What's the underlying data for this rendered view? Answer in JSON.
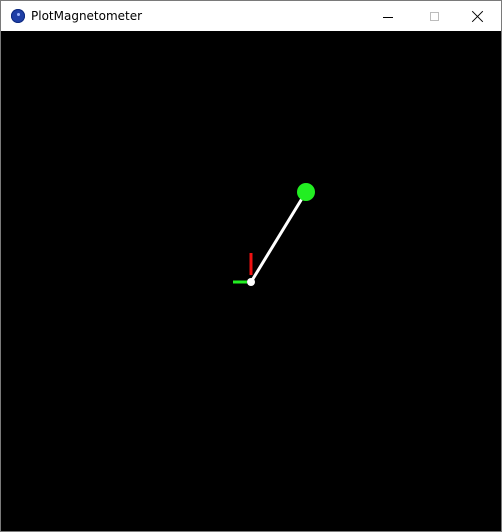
{
  "window": {
    "title": "PlotMagnetometer",
    "icon": "app-icon"
  },
  "caption_buttons": {
    "minimize": "minimize-icon",
    "maximize": "maximize-icon",
    "close": "close-icon"
  },
  "plot": {
    "background": "#000000",
    "vector_color": "#ffffff",
    "tip_color": "#22ee22",
    "origin_color": "#ffffff",
    "axis_x_color": "#22ee22",
    "axis_y_color": "#ee1111"
  }
}
